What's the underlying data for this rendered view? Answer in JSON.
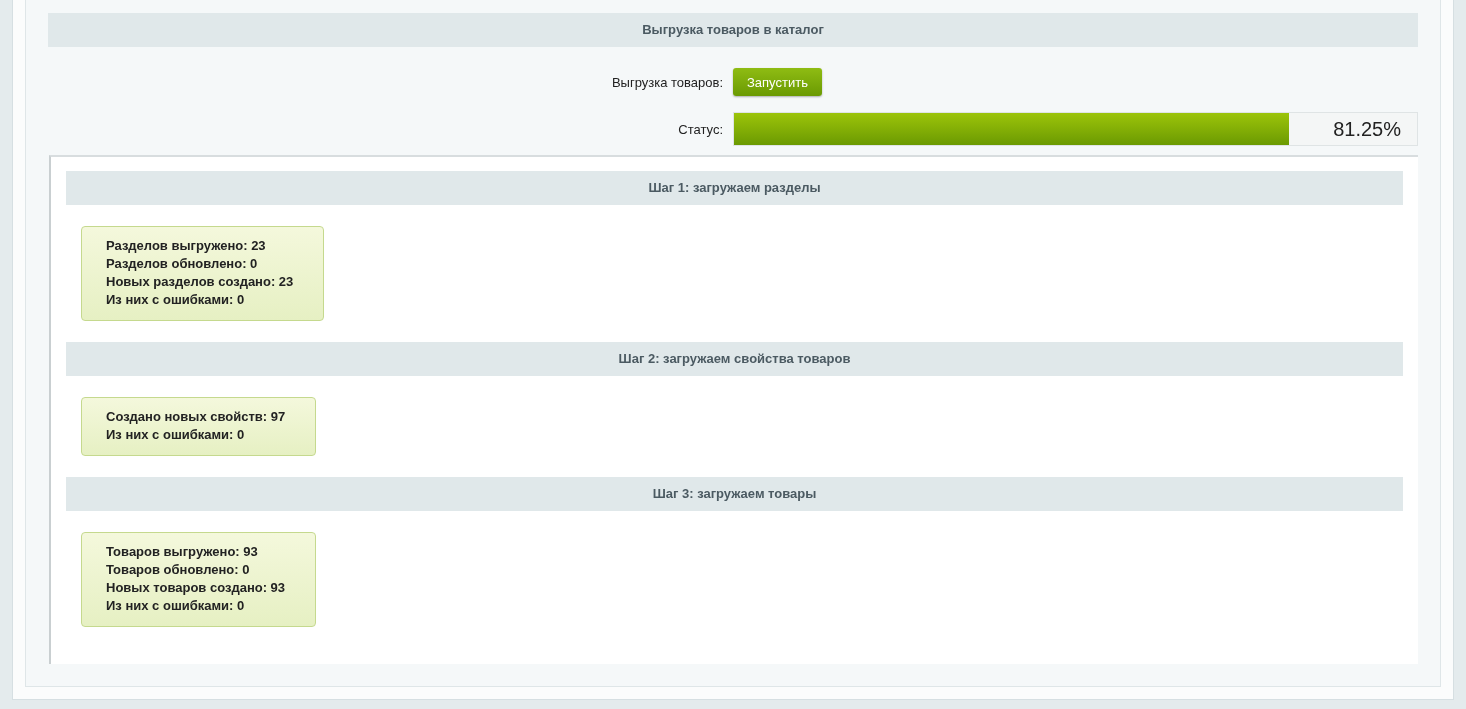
{
  "title": "Выгрузка товаров в каталог",
  "form": {
    "run_label": "Выгрузка товаров:",
    "run_button": "Запустить",
    "status_label": "Статус:",
    "progress": {
      "level": 0.8125,
      "reading": "81.25%"
    }
  },
  "steps": [
    {
      "title": "Шаг 1: загружаем разделы",
      "lines": [
        "Разделов выгружено: 23",
        "Разделов обновлено: 0",
        "Новых разделов создано: 23",
        "Из них с ошибками: 0"
      ]
    },
    {
      "title": "Шаг 2: загружаем свойства товаров",
      "lines": [
        "Создано новых свойств: 97",
        "Из них с ошибками: 0"
      ]
    },
    {
      "title": "Шаг 3: загружаем товары",
      "lines": [
        "Товаров выгружено: 93",
        "Товаров обновлено: 0",
        "Новых товаров создано: 93",
        "Из них с ошибками: 0"
      ]
    }
  ]
}
